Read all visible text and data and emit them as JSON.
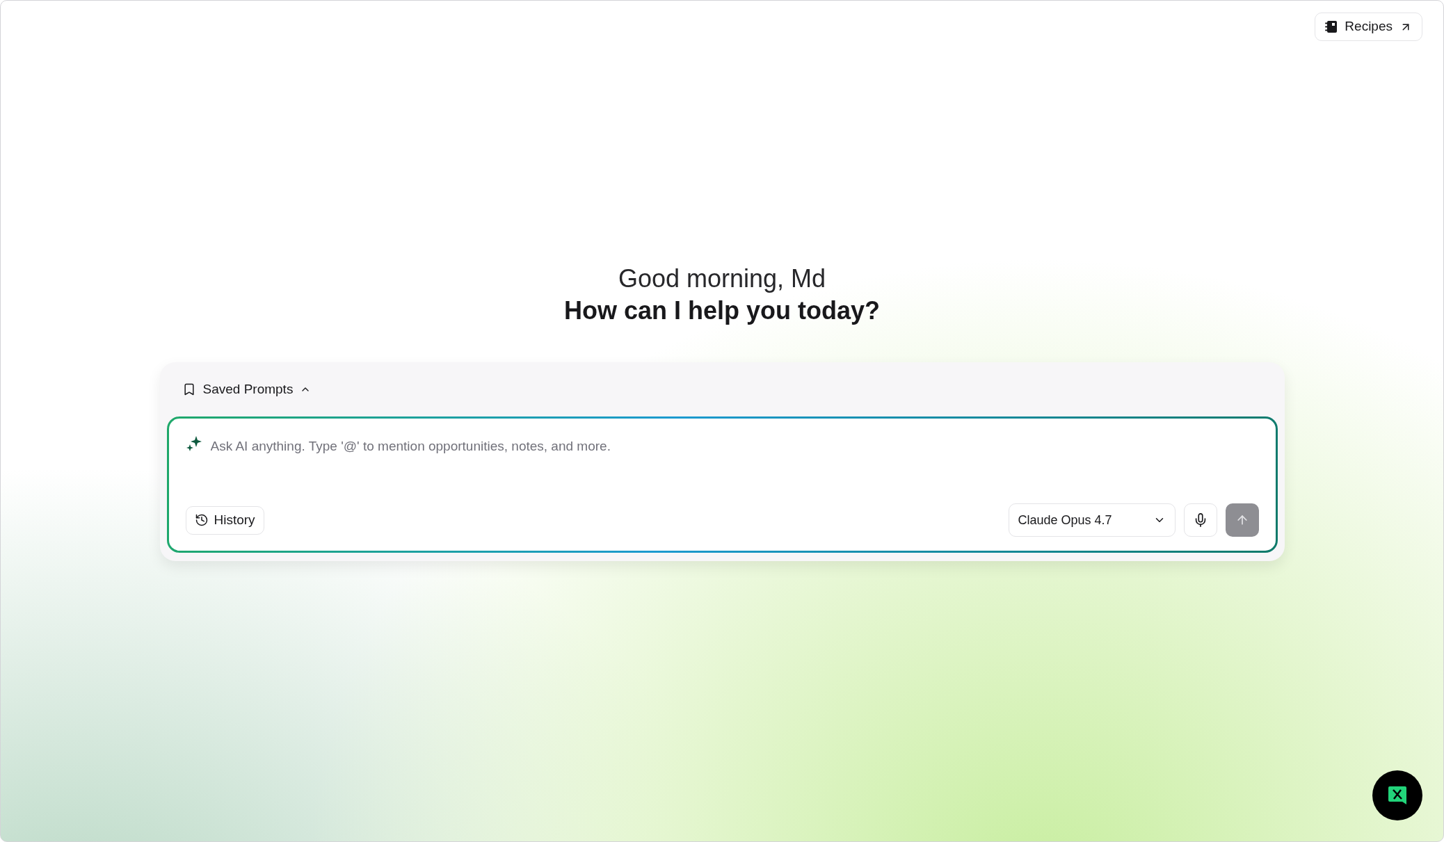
{
  "top_bar": {
    "recipes_button": {
      "label": "Recipes"
    }
  },
  "greeting": {
    "line_1": "Good morning, Md",
    "line_2": "How can I help you today?"
  },
  "composer": {
    "saved_prompts": {
      "label": "Saved Prompts",
      "expanded": true
    },
    "input": {
      "placeholder": "Ask AI anything. Type '@' to mention opportunities, notes, and more."
    },
    "history_button": {
      "label": "History"
    },
    "model_select": {
      "value": "Claude Opus 4.7"
    },
    "send_button": {
      "disabled": true
    }
  }
}
